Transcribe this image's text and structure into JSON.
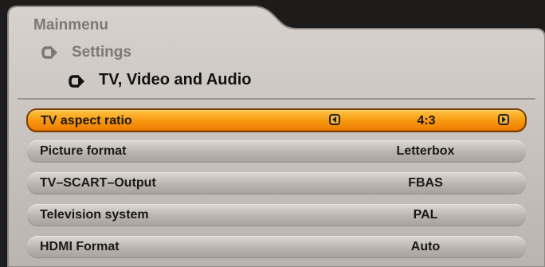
{
  "breadcrumb": {
    "main": "Mainmenu",
    "settings": "Settings",
    "current": "TV, Video and Audio"
  },
  "rows": [
    {
      "label": "TV aspect ratio",
      "value": "4:3",
      "selected": true
    },
    {
      "label": "Picture format",
      "value": "Letterbox",
      "selected": false
    },
    {
      "label": "TV–SCART–Output",
      "value": "FBAS",
      "selected": false
    },
    {
      "label": "Television system",
      "value": "PAL",
      "selected": false
    },
    {
      "label": "HDMI Format",
      "value": "Auto",
      "selected": false
    }
  ],
  "colors": {
    "panel": "#c9c4c0",
    "highlight": "#f89a10",
    "row": "#bdb8b4"
  },
  "icons": {
    "breadcrumb_arrow": "curved-arrow-icon",
    "left": "left-arrow-button-icon",
    "right": "right-arrow-button-icon"
  }
}
